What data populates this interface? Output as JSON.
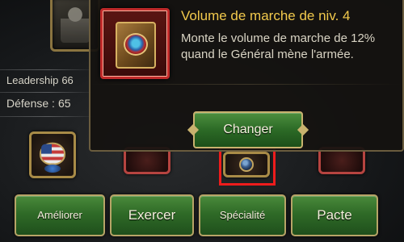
{
  "hero": {
    "stats": [
      {
        "label": "Leadership",
        "value": "66"
      },
      {
        "label": "Défense :",
        "value": "65"
      }
    ]
  },
  "tooltip": {
    "title": "Volume de marche de niv. 4",
    "description": "Monte le volume de marche de 12% quand le Général mène l'armée.",
    "change_label": "Changer"
  },
  "actions": {
    "improve_label": "Améliorer",
    "train_label": "Exercer",
    "specialty_label": "Spécialité",
    "pact_label": "Pacte"
  },
  "colors": {
    "title_gold": "#f2c94c",
    "button_green": "#2f6a27",
    "highlight_red": "#ee1c1c"
  }
}
